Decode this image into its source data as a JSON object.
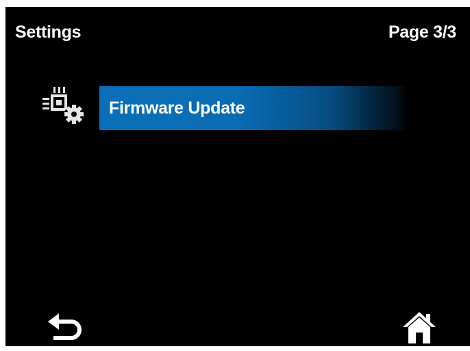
{
  "header": {
    "title": "Settings",
    "page_indicator": "Page 3/3"
  },
  "menu": {
    "items": [
      {
        "label": "Firmware Update",
        "icon": "firmware-chip-gear-icon",
        "selected": true
      }
    ]
  },
  "footer": {
    "back_icon": "back-arrow-icon",
    "home_icon": "home-icon"
  },
  "colors": {
    "screen_background": "#000000",
    "highlight": "#0a6fb8",
    "text": "#ffffff"
  }
}
